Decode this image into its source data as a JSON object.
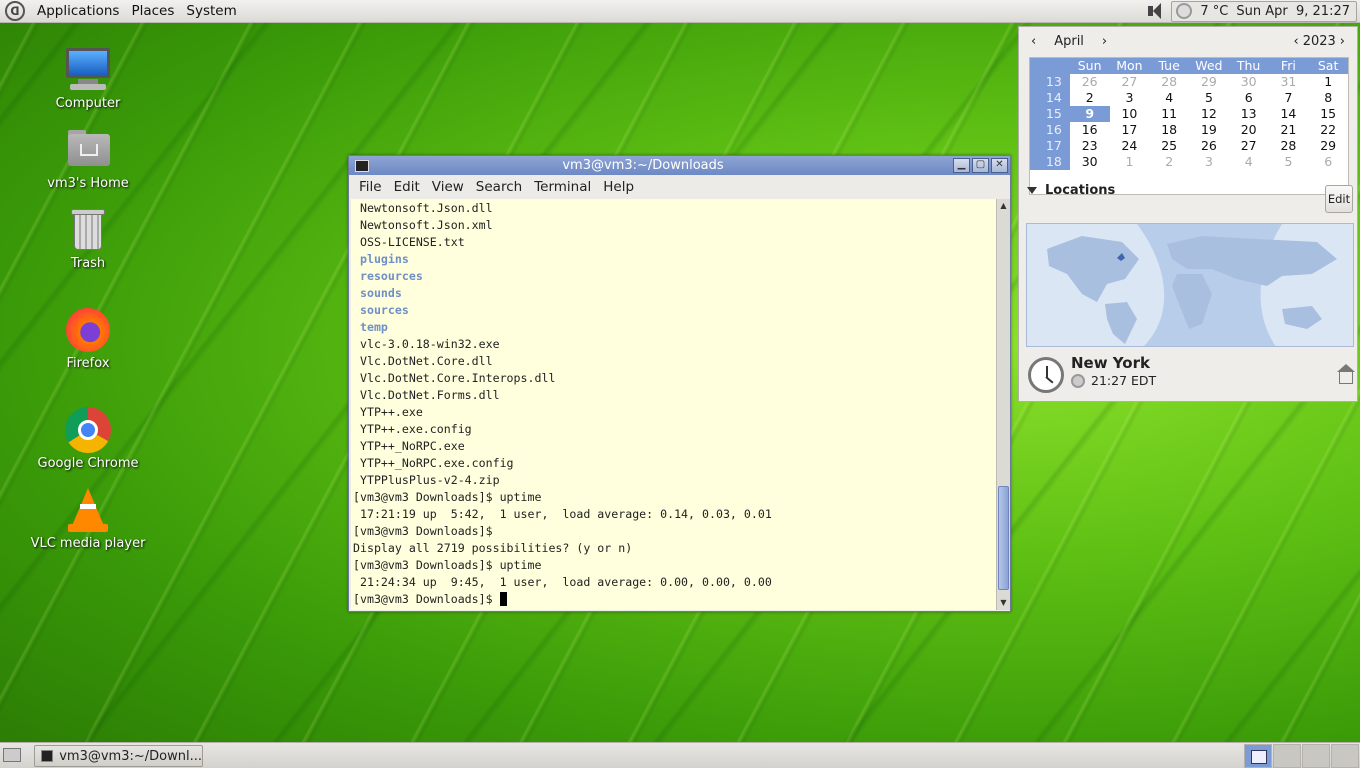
{
  "top_panel": {
    "menus": [
      "Applications",
      "Places",
      "System"
    ],
    "temperature": "7 °C",
    "datetime": "Sun Apr  9, 21:27"
  },
  "desktop_icons": [
    {
      "label": "Computer",
      "icon": "computer-icon"
    },
    {
      "label": "vm3's Home",
      "icon": "home-folder-icon"
    },
    {
      "label": "Trash",
      "icon": "trash-icon"
    },
    {
      "label": "Firefox",
      "icon": "firefox-icon"
    },
    {
      "label": "Google Chrome",
      "icon": "chrome-icon"
    },
    {
      "label": "VLC media player",
      "icon": "vlc-icon"
    }
  ],
  "terminal": {
    "title": "vm3@vm3:~/Downloads",
    "menu": [
      "File",
      "Edit",
      "View",
      "Search",
      "Terminal",
      "Help"
    ],
    "lines": [
      {
        "text": " Newtonsoft.Json.dll",
        "kind": "file"
      },
      {
        "text": " Newtonsoft.Json.xml",
        "kind": "file"
      },
      {
        "text": " OSS-LICENSE.txt",
        "kind": "file"
      },
      {
        "text": " plugins",
        "kind": "dir"
      },
      {
        "text": " resources",
        "kind": "dir"
      },
      {
        "text": " sounds",
        "kind": "dir"
      },
      {
        "text": " sources",
        "kind": "dir"
      },
      {
        "text": " temp",
        "kind": "dir"
      },
      {
        "text": " vlc-3.0.18-win32.exe",
        "kind": "file"
      },
      {
        "text": " Vlc.DotNet.Core.dll",
        "kind": "file"
      },
      {
        "text": " Vlc.DotNet.Core.Interops.dll",
        "kind": "file"
      },
      {
        "text": " Vlc.DotNet.Forms.dll",
        "kind": "file"
      },
      {
        "text": " YTP++.exe",
        "kind": "file"
      },
      {
        "text": " YTP++.exe.config",
        "kind": "file"
      },
      {
        "text": " YTP++_NoRPC.exe",
        "kind": "file"
      },
      {
        "text": " YTP++_NoRPC.exe.config",
        "kind": "file"
      },
      {
        "text": " YTPPlusPlus-v2-4.zip",
        "kind": "file"
      },
      {
        "text": "[vm3@vm3 Downloads]$ uptime",
        "kind": "file"
      },
      {
        "text": " 17:21:19 up  5:42,  1 user,  load average: 0.14, 0.03, 0.01",
        "kind": "file"
      },
      {
        "text": "[vm3@vm3 Downloads]$ ",
        "kind": "file"
      },
      {
        "text": "Display all 2719 possibilities? (y or n)",
        "kind": "file"
      },
      {
        "text": "[vm3@vm3 Downloads]$ uptime",
        "kind": "file"
      },
      {
        "text": " 21:24:34 up  9:45,  1 user,  load average: 0.00, 0.00, 0.00",
        "kind": "file"
      }
    ],
    "prompt": "[vm3@vm3 Downloads]$ "
  },
  "calendar": {
    "month": "April",
    "year": "2023",
    "day_names": [
      "Sun",
      "Mon",
      "Tue",
      "Wed",
      "Thu",
      "Fri",
      "Sat"
    ],
    "weeks": [
      {
        "wk": "13",
        "days": [
          "26",
          "27",
          "28",
          "29",
          "30",
          "31",
          "1"
        ],
        "other": [
          0,
          1,
          2,
          3,
          4,
          5
        ]
      },
      {
        "wk": "14",
        "days": [
          "2",
          "3",
          "4",
          "5",
          "6",
          "7",
          "8"
        ],
        "other": []
      },
      {
        "wk": "15",
        "days": [
          "9",
          "10",
          "11",
          "12",
          "13",
          "14",
          "15"
        ],
        "other": [],
        "selected": 0
      },
      {
        "wk": "16",
        "days": [
          "16",
          "17",
          "18",
          "19",
          "20",
          "21",
          "22"
        ],
        "other": []
      },
      {
        "wk": "17",
        "days": [
          "23",
          "24",
          "25",
          "26",
          "27",
          "28",
          "29"
        ],
        "other": []
      },
      {
        "wk": "18",
        "days": [
          "30",
          "1",
          "2",
          "3",
          "4",
          "5",
          "6"
        ],
        "other": [
          1,
          2,
          3,
          4,
          5,
          6
        ]
      }
    ],
    "locations_label": "Locations",
    "edit_label": "Edit",
    "city": "New York",
    "city_time": "21:27 EDT"
  },
  "taskbar": {
    "task_label": "vm3@vm3:~/Downl...",
    "workspaces": 4,
    "active_workspace": 0
  },
  "colors": {
    "selection": "#7b9bd6",
    "terminal_bg": "#ffffdd",
    "directory_text": "#6f8fc8"
  }
}
